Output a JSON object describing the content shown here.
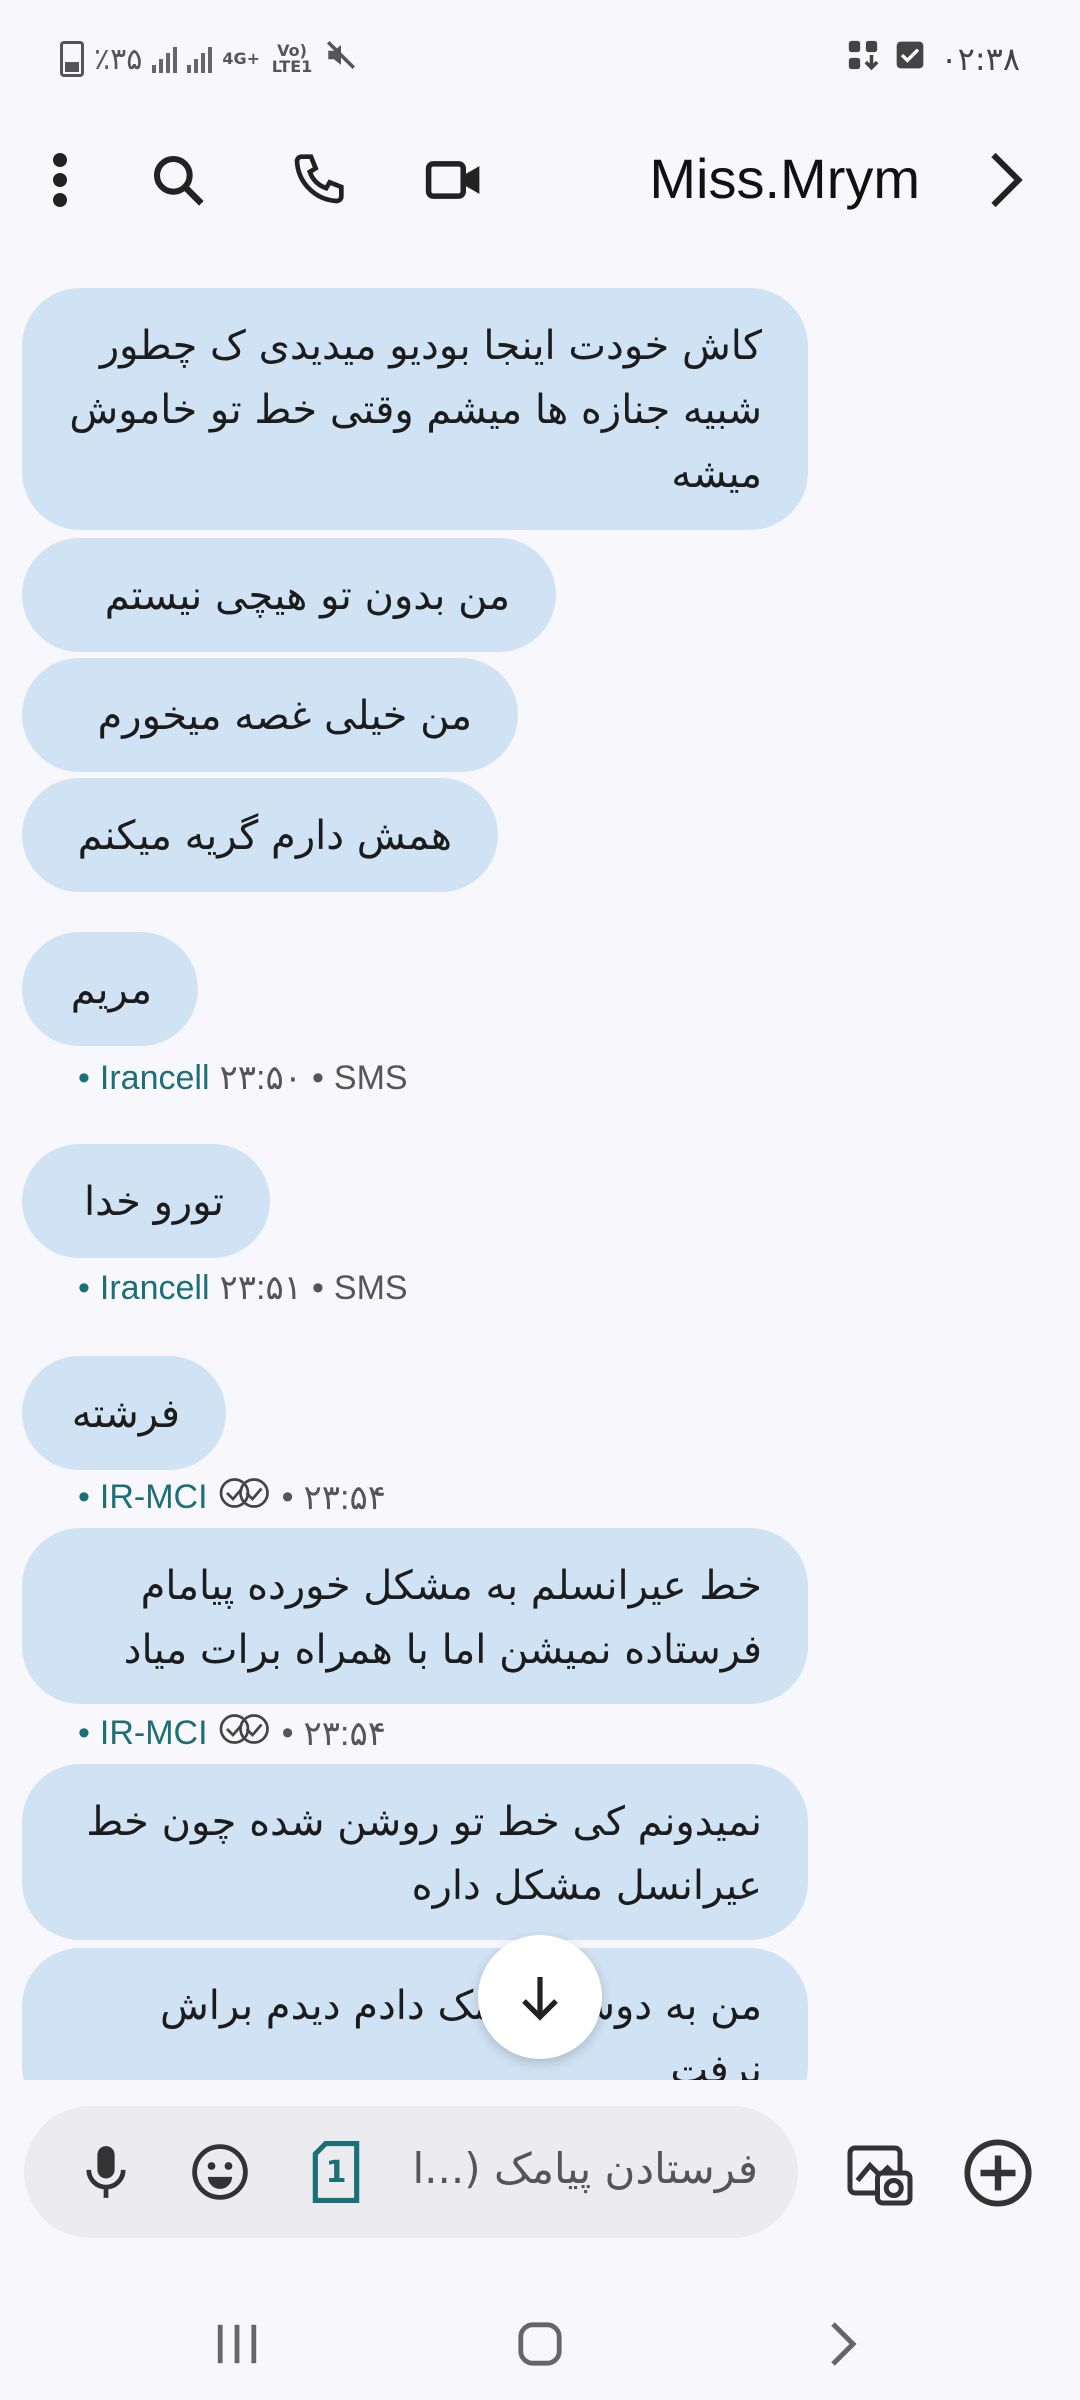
{
  "status_bar": {
    "battery": "٪۳۵",
    "network_type": "4G+",
    "volte": "Vo) LTE1",
    "time": "۰۲:۳۸"
  },
  "app_bar": {
    "contact_name": "Miss.Mrym",
    "icons": [
      "more-vert-icon",
      "search-icon",
      "phone-icon",
      "video-call-icon",
      "chevron-right-icon"
    ]
  },
  "messages": [
    {
      "text": "کاش خودت اینجا بودیو میدیدی ک چطور شبیه جنازه ها میشم وقتی خط تو خاموش میشه"
    },
    {
      "text": "من بدون تو هیچی نیستم"
    },
    {
      "text": "من خیلی غصه میخورم"
    },
    {
      "text": "همش دارم گریه میکنم"
    },
    {
      "text": "مریم",
      "meta": {
        "carrier": "Irancell",
        "time": "۲۳:۵۰",
        "type": "SMS"
      }
    },
    {
      "text": "تورو خدا",
      "meta": {
        "carrier": "Irancell",
        "time": "۲۳:۵۱",
        "type": "SMS"
      }
    },
    {
      "text": "فرشته",
      "meta": {
        "carrier": "IR-MCI",
        "time": "۲۳:۵۴"
      }
    },
    {
      "text": "خط عیرانسلم به مشکل خورده پیامام فرستاده نمیشن اما با همراه برات میاد",
      "meta": {
        "carrier": "IR-MCI",
        "time": "۲۳:۵۴"
      }
    },
    {
      "text": "نمیدونم کی خط تو روشن شده چون خط عیرانسل مشکل داره"
    },
    {
      "text": "من به دوستم پیامک دادم دیدم براش نرفت"
    }
  ],
  "composer": {
    "placeholder": "فرستادن پیامک (...ا",
    "sim_label": "1"
  },
  "colors": {
    "bubble": "#d0e3f4",
    "background": "#f8f8fc",
    "carrier": "#1b6f77"
  }
}
